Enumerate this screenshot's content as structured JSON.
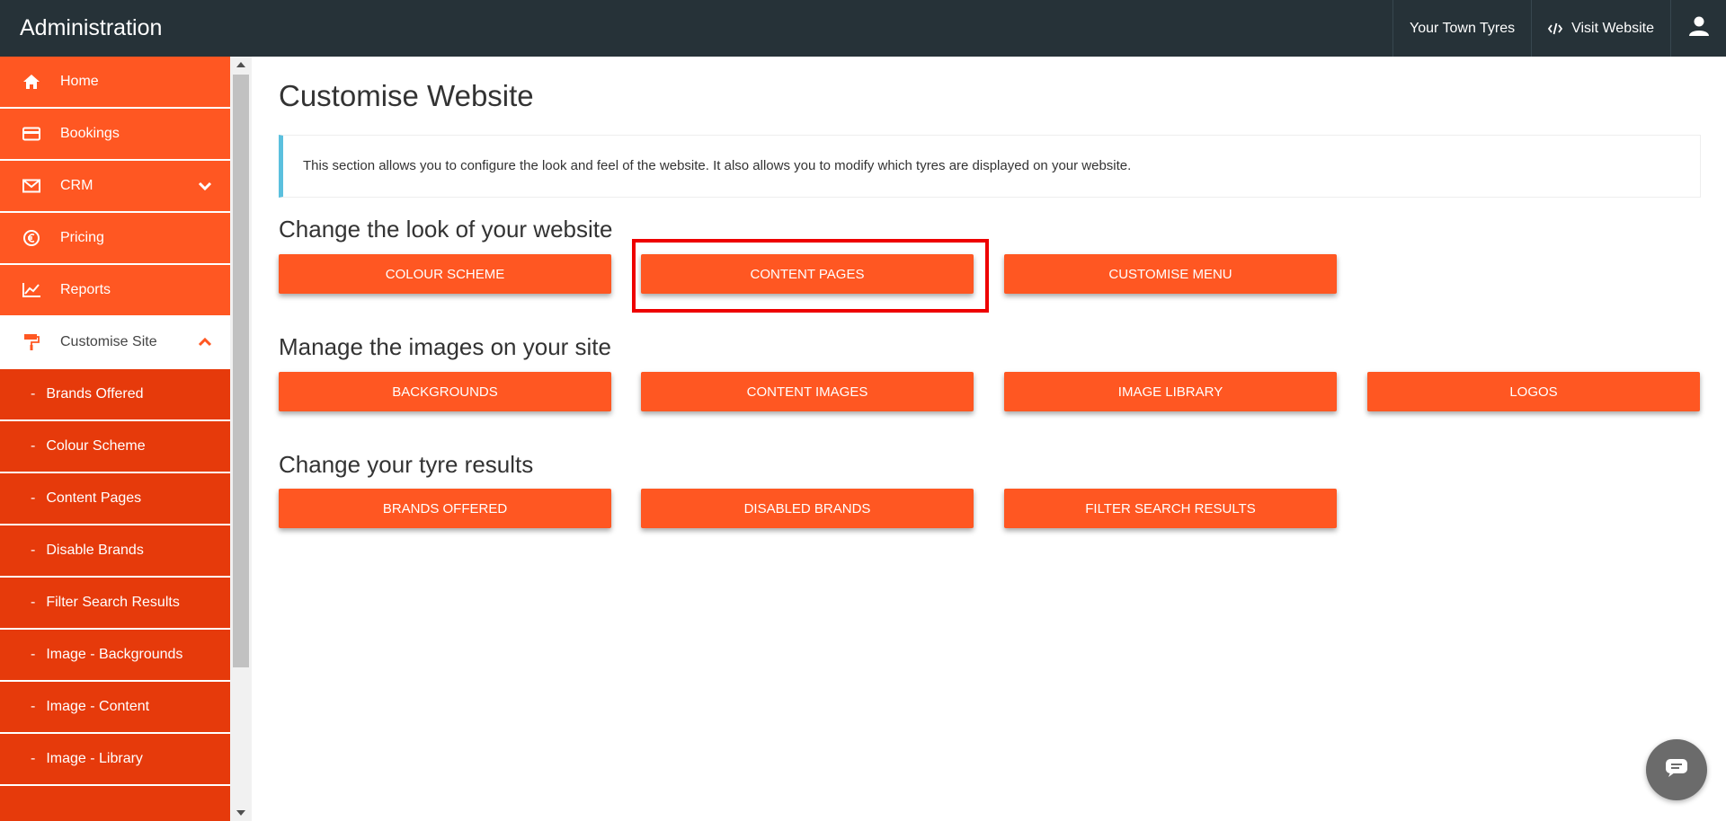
{
  "topbar": {
    "title": "Administration",
    "company": "Your Town Tyres",
    "visit_website": "Visit Website",
    "user_icon": "user-icon"
  },
  "sidebar": {
    "items": [
      {
        "label": "Home",
        "icon": "home-icon"
      },
      {
        "label": "Bookings",
        "icon": "credit-card-icon"
      },
      {
        "label": "CRM",
        "icon": "envelope-icon"
      },
      {
        "label": "Pricing",
        "icon": "euro-icon"
      },
      {
        "label": "Reports",
        "icon": "line-chart-icon"
      },
      {
        "label": "Customise Site",
        "icon": "paint-roller-icon"
      }
    ],
    "subitems": [
      {
        "label": "Brands Offered"
      },
      {
        "label": "Colour Scheme"
      },
      {
        "label": "Content Pages"
      },
      {
        "label": "Disable Brands"
      },
      {
        "label": "Filter Search Results"
      },
      {
        "label": "Image - Backgrounds"
      },
      {
        "label": "Image - Content"
      },
      {
        "label": "Image - Library"
      }
    ],
    "dash": "-"
  },
  "main": {
    "title": "Customise Website",
    "info": "This section allows you to configure the look and feel of the website. It also allows you to modify which tyres are displayed on your website.",
    "sections": [
      {
        "title": "Change the look of your website",
        "buttons": [
          "COLOUR SCHEME",
          "CONTENT PAGES",
          "CUSTOMISE MENU"
        ]
      },
      {
        "title": "Manage the images on your site",
        "buttons": [
          "BACKGROUNDS",
          "CONTENT IMAGES",
          "IMAGE LIBRARY",
          "LOGOS"
        ]
      },
      {
        "title": "Change your tyre results",
        "buttons": [
          "BRANDS OFFERED",
          "DISABLED BRANDS",
          "FILTER SEARCH RESULTS"
        ]
      }
    ]
  },
  "colors": {
    "accent": "#ff5722",
    "sub_accent": "#e63a0b",
    "topbar": "#263238",
    "info_border": "#5bc0de",
    "highlight": "#ee0000"
  }
}
